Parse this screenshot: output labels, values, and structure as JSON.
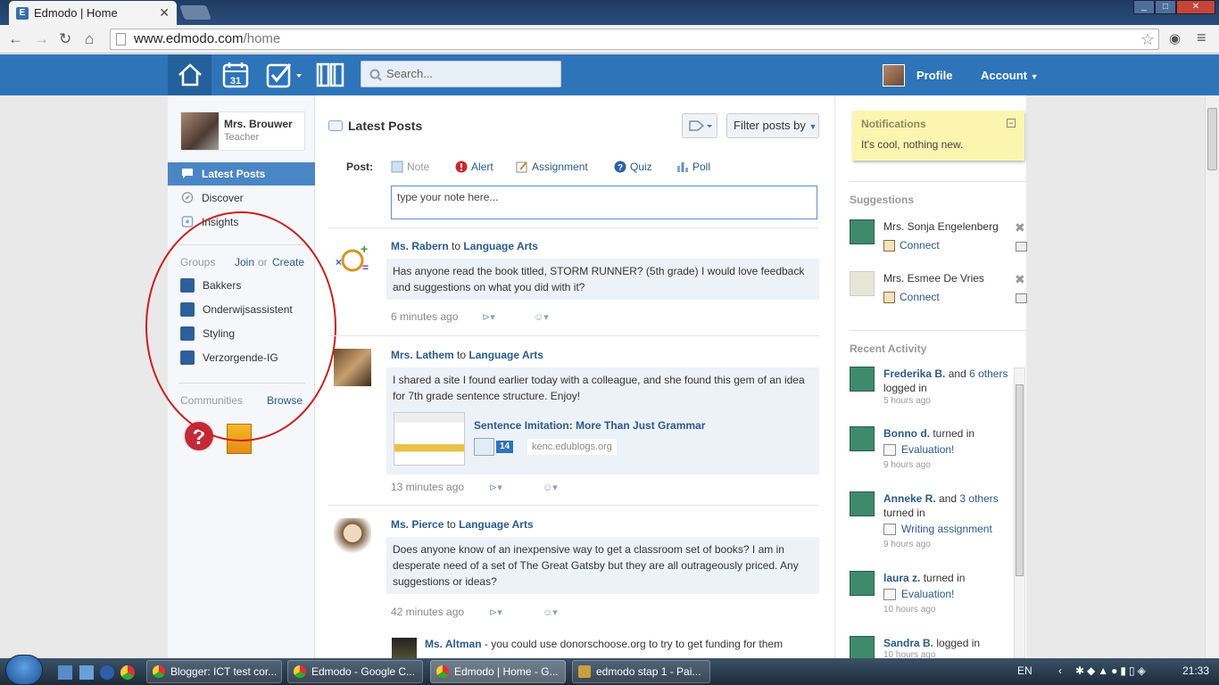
{
  "browser": {
    "tab_title": "Edmodo | Home",
    "tab_icon": "E",
    "url_domain": "www.edmodo.com",
    "url_path": "/home"
  },
  "header": {
    "search_placeholder": "Search...",
    "calendar_day": "31",
    "profile": "Profile",
    "account": "Account"
  },
  "user": {
    "name": "Mrs. Brouwer",
    "role": "Teacher"
  },
  "left_nav": [
    {
      "label": "Latest Posts",
      "icon": "speech-bubble-icon"
    },
    {
      "label": "Discover",
      "icon": "compass-icon"
    },
    {
      "label": "Insights",
      "icon": "insights-icon"
    }
  ],
  "groups": {
    "heading": "Groups",
    "join": "Join",
    "or": "or",
    "create": "Create",
    "items": [
      "Bakkers",
      "Onderwijsassistent",
      "Styling",
      "Verzorgende-IG"
    ]
  },
  "communities": {
    "heading": "Communities",
    "browse": "Browse",
    "help_glyph": "?"
  },
  "feed": {
    "title": "Latest Posts",
    "filter": "Filter posts by",
    "post_label": "Post:",
    "post_types": [
      "Note",
      "Alert",
      "Assignment",
      "Quiz",
      "Poll"
    ],
    "note_placeholder": "type your note here...",
    "to": "to",
    "posts": [
      {
        "author": "Ms. Rabern",
        "group": "Language Arts",
        "text": "Has anyone read the book titled, STORM RUNNER? (5th grade) I would love feedback and suggestions on what you did with it?",
        "time": "6 minutes ago"
      },
      {
        "author": "Mrs. Lathem",
        "group": "Language Arts",
        "text": "I shared a site I found earlier today with a colleague, and she found this gem of an idea for 7th grade sentence structure. Enjoy!",
        "link_title": "Sentence Imitation: More Than Just Grammar",
        "link_count": "14",
        "link_domain": "kenc.edublogs.org",
        "time": "13 minutes ago"
      },
      {
        "author": "Ms. Pierce",
        "group": "Language Arts",
        "text": "Does anyone know of an inexpensive way to get a classroom set of books? I am in desperate need of a set of The Great Gatsby but they are all outrageously priced. Any suggestions or ideas?",
        "time": "42 minutes ago"
      }
    ],
    "reply": {
      "author": "Ms. Altman",
      "text": " - you could use donorschoose.org to try to get funding for them"
    }
  },
  "notifications": {
    "title": "Notifications",
    "message": "It's cool, nothing new."
  },
  "suggestions": {
    "heading": "Suggestions",
    "connect": "Connect",
    "items": [
      "Mrs. Sonja Engelenberg",
      "Mrs. Esmee De Vries"
    ]
  },
  "recent_activity": {
    "heading": "Recent Activity",
    "items": [
      {
        "name": "Frederika B.",
        "and": "and",
        "others": "6 others",
        "action": "logged in",
        "time": "5 hours ago"
      },
      {
        "name": "Bonno d.",
        "action": "turned in",
        "item": "Evaluation!",
        "time": "9 hours ago"
      },
      {
        "name": "Anneke R.",
        "and": "and",
        "others": "3 others",
        "action": "turned in",
        "item": "Writing assignment",
        "time": "9 hours ago"
      },
      {
        "name": "laura z.",
        "action": "turned in",
        "item": "Evaluation!",
        "time": "10 hours ago"
      },
      {
        "name": "Sandra B.",
        "action": "logged in",
        "time": "10 hours ago"
      }
    ]
  },
  "taskbar": {
    "buttons": [
      "Blogger: ICT test cor...",
      "Edmodo - Google C...",
      "Edmodo | Home - G...",
      "edmodo stap 1 - Pai..."
    ],
    "lang": "EN",
    "clock": "21:33"
  },
  "colors": {
    "header": "#2e74b8",
    "link": "#2b5a8c",
    "active_nav": "#4a86c4",
    "annotation": "#cc1f1f",
    "notif_bg": "#fbf5b0"
  }
}
